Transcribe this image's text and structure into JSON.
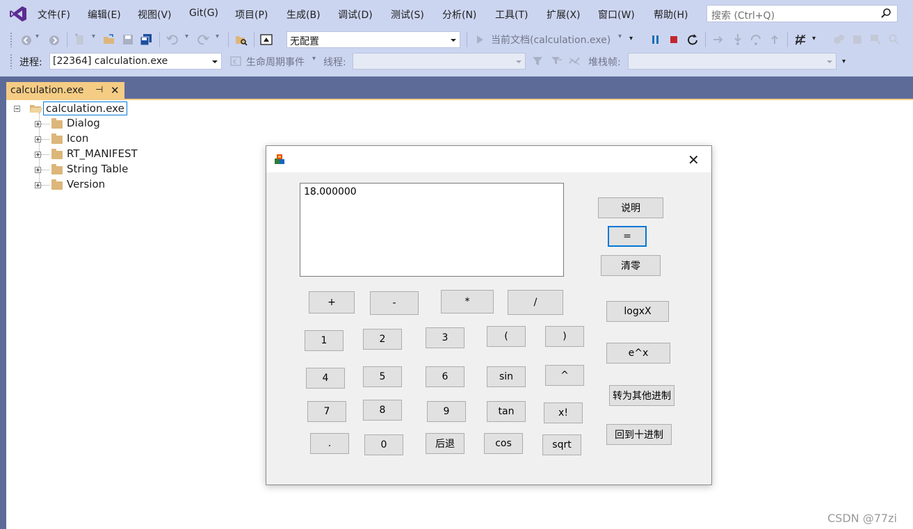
{
  "menu": {
    "items": [
      "文件(F)",
      "编辑(E)",
      "视图(V)",
      "Git(G)",
      "项目(P)",
      "生成(B)",
      "调试(D)",
      "测试(S)",
      "分析(N)",
      "工具(T)",
      "扩展(X)",
      "窗口(W)",
      "帮助(H)"
    ],
    "search_placeholder": "搜索 (Ctrl+Q)"
  },
  "toolbar": {
    "config_value": "无配置",
    "run_label": "当前文档(calculation.exe)",
    "process_label": "进程:",
    "process_value": "[22364] calculation.exe",
    "lifecycle_label": "生命周期事件",
    "thread_label": "线程:",
    "stackframe_label": "堆栈帧:"
  },
  "tab": {
    "title": "calculation.exe",
    "pin_glyph": "⊣",
    "close_glyph": "✕"
  },
  "tree": {
    "root": "calculation.exe",
    "children": [
      "Dialog",
      "Icon",
      "RT_MANIFEST",
      "String Table",
      "Version"
    ]
  },
  "dialog": {
    "close_glyph": "✕",
    "display_text": "18.000000",
    "buttons": {
      "help": "说明",
      "equals": "=",
      "clear": "清零",
      "plus": "+",
      "minus": "-",
      "multiply": "*",
      "divide": "/",
      "log": "logxX",
      "exp": "e^x",
      "n1": "1",
      "n2": "2",
      "n3": "3",
      "lparen": "(",
      "rparen": ")",
      "n4": "4",
      "n5": "5",
      "n6": "6",
      "sin": "sin",
      "pow": "^",
      "convert": "转为其他进制",
      "n7": "7",
      "n8": "8",
      "n9": "9",
      "tan": "tan",
      "fact": "x!",
      "dot": ".",
      "n0": "0",
      "back": "后退",
      "cos": "cos",
      "sqrt": "sqrt",
      "decimal": "回到十进制"
    }
  },
  "watermark": "CSDN @77zi"
}
